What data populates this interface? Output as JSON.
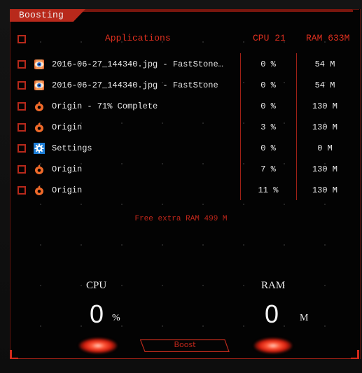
{
  "window": {
    "tab_title": "Boosting"
  },
  "header": {
    "select_all_checked": false,
    "applications_label": "Applications",
    "cpu_label": "CPU 21",
    "ram_label": "RAM 633M"
  },
  "rows": [
    {
      "icon": "faststone-eye-icon",
      "name": "2016-06-27_144340.jpg  -  FastStone…",
      "cpu": "0 %",
      "ram": "54 M",
      "checked": false
    },
    {
      "icon": "faststone-eye-icon",
      "name": "2016-06-27_144340.jpg - FastStone",
      "cpu": "0 %",
      "ram": "54 M",
      "checked": false
    },
    {
      "icon": "origin-icon",
      "name": "Origin - 71% Complete",
      "cpu": "0 %",
      "ram": "130 M",
      "checked": false
    },
    {
      "icon": "origin-icon",
      "name": "Origin",
      "cpu": "3 %",
      "ram": "130 M",
      "checked": false
    },
    {
      "icon": "settings-gear-icon",
      "name": "Settings",
      "cpu": "0 %",
      "ram": "0 M",
      "checked": false
    },
    {
      "icon": "origin-icon",
      "name": "Origin",
      "cpu": "7 %",
      "ram": "130 M",
      "checked": false
    },
    {
      "icon": "origin-icon",
      "name": "Origin",
      "cpu": "11 %",
      "ram": "130 M",
      "checked": false
    }
  ],
  "summary": {
    "free_ram_text": "Free extra RAM 499 M"
  },
  "gauges": {
    "cpu": {
      "label": "CPU",
      "value": "0",
      "unit": "%"
    },
    "ram": {
      "label": "RAM",
      "value": "0",
      "unit": "M"
    }
  },
  "actions": {
    "boost_label": "Boost"
  },
  "colors": {
    "accent": "#b8291b",
    "header_text": "#e0301f",
    "text": "#ececec",
    "background": "#030303"
  }
}
